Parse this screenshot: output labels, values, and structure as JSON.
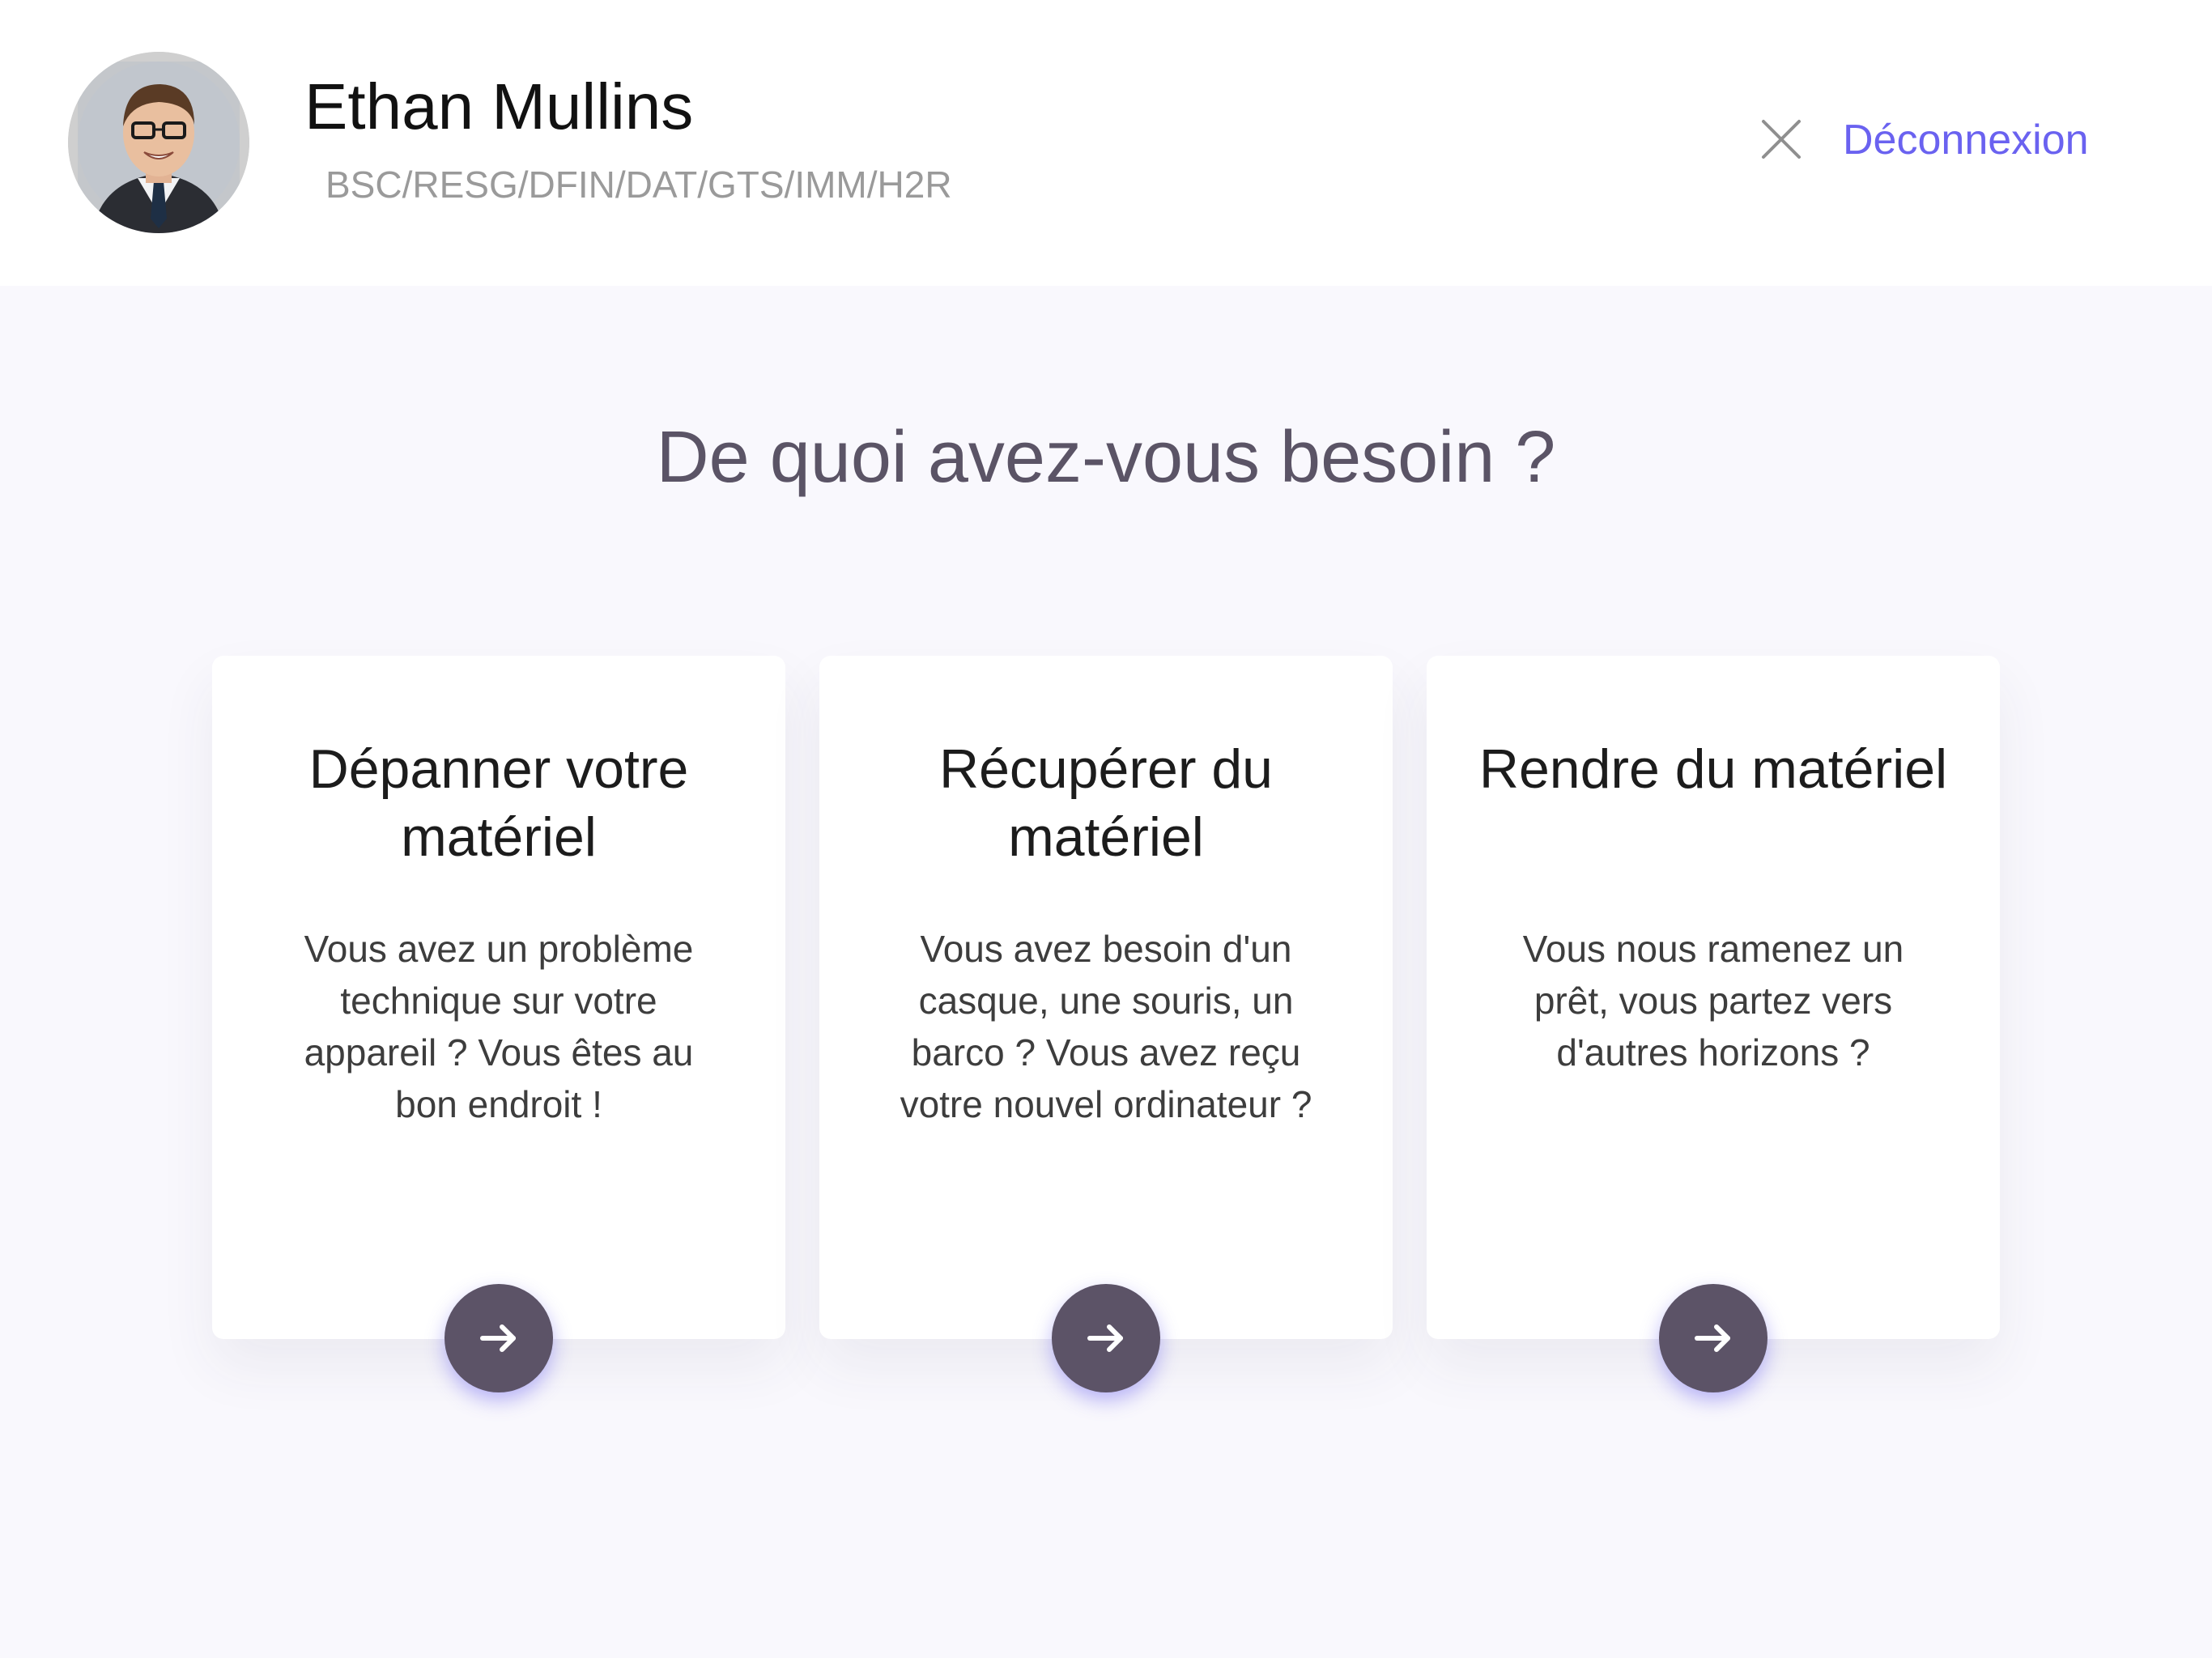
{
  "header": {
    "user_name": "Ethan Mullins",
    "user_path": "BSC/RESG/DFIN/DAT/GTS/IMM/H2R",
    "avatar_icon": "user-avatar-photo",
    "close_icon": "close-icon",
    "logout_label": "Déconnexion"
  },
  "main": {
    "title": "De quoi avez-vous besoin ?",
    "cards": [
      {
        "title": "Dépanner votre matériel",
        "description": "Vous avez un problème technique sur votre appareil ? Vous êtes au bon endroit !",
        "button_icon": "arrow-right-icon"
      },
      {
        "title": "Récupérer du matériel",
        "description": "Vous avez besoin d'un casque, une souris, un barco ? Vous avez reçu votre nouvel ordinateur ?",
        "button_icon": "arrow-right-icon"
      },
      {
        "title": "Rendre du matériel",
        "description": "Vous nous ramenez un prêt, vous partez vers d'autres horizons ?",
        "button_icon": "arrow-right-icon"
      }
    ]
  },
  "colors": {
    "accent": "#6a62f0",
    "button": "#5c5367",
    "title": "#5b5466",
    "background": "#f9f8fd"
  }
}
